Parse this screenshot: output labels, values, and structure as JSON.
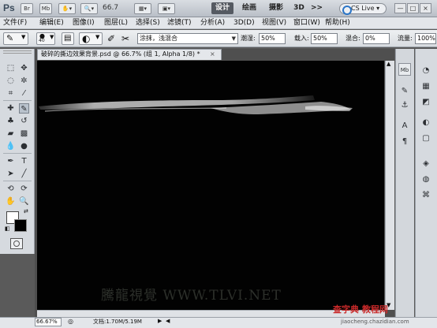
{
  "app": {
    "logo": "Ps",
    "zoom": "66.7",
    "icons": [
      "bridge-icon",
      "mini-bridge-icon",
      "layout-icon",
      "screen-mode-icon"
    ],
    "workspaces": [
      "设计",
      "绘画",
      "摄影",
      "3D"
    ],
    "active_workspace": "设计",
    "more": ">>",
    "cs_live": "CS Live",
    "window_controls": [
      "—",
      "□",
      "×"
    ]
  },
  "menu": [
    "文件(F)",
    "编辑(E)",
    "图像(I)",
    "图层(L)",
    "选择(S)",
    "滤镜(T)",
    "分析(A)",
    "3D(D)",
    "视图(V)",
    "窗口(W)",
    "帮助(H)"
  ],
  "options": {
    "brush_size": "40",
    "mode": "涂抹，浅混合",
    "wetness_label": "潮湿:",
    "wetness": "50%",
    "load_label": "载入:",
    "load": "50%",
    "mix_label": "混合:",
    "mix": "0%",
    "flow_label": "流量:",
    "flow": "100%"
  },
  "document": {
    "tab_title": "破碎的撕边效果背景.psd @ 66.7% (组 1, Alpha 1/8) *",
    "close": "×",
    "watermark": "騰龍視覺 WWW.TLVI.NET"
  },
  "status": {
    "zoom": "66.67%",
    "doc_info": "文档:1.70M/5.19M"
  },
  "overlay": {
    "site": "查字典 教程网",
    "url": "jiaocheng.chazidian.com"
  },
  "colors": {
    "foreground": "#ffffff",
    "background": "#000000",
    "active_workspace_bg": "#555a62"
  }
}
